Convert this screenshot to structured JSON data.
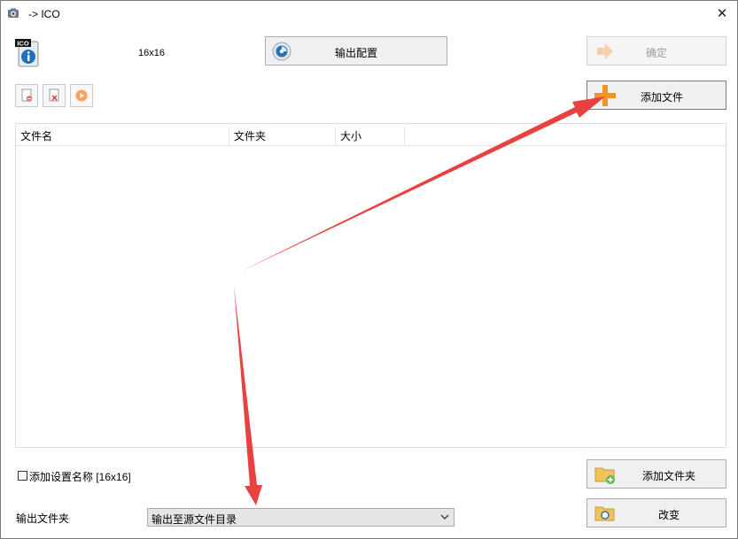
{
  "window": {
    "title": "-> ICO",
    "close_glyph": "✕"
  },
  "preview": {
    "badge": "ICO",
    "size": "16x16"
  },
  "toolbar": {
    "output_config_label": "输出配置",
    "ok_label": "确定",
    "add_file_label": "添加文件",
    "small_buttons": [
      "remove-icon",
      "clear-icon",
      "play-icon"
    ]
  },
  "filelist": {
    "columns": [
      "文件名",
      "文件夹",
      "大小"
    ]
  },
  "bottom": {
    "add_setting_name_label": "添加设置名称 [16x16]",
    "add_setting_name_checked": false,
    "add_folder_label": "添加文件夹",
    "output_folder_label": "输出文件夹",
    "output_folder_value": "输出至源文件目录",
    "change_label": "改变"
  },
  "colors": {
    "annotation_arrow": "#e8413f",
    "add_icon": "#f39423",
    "config_icon": "#2d6fb3"
  }
}
